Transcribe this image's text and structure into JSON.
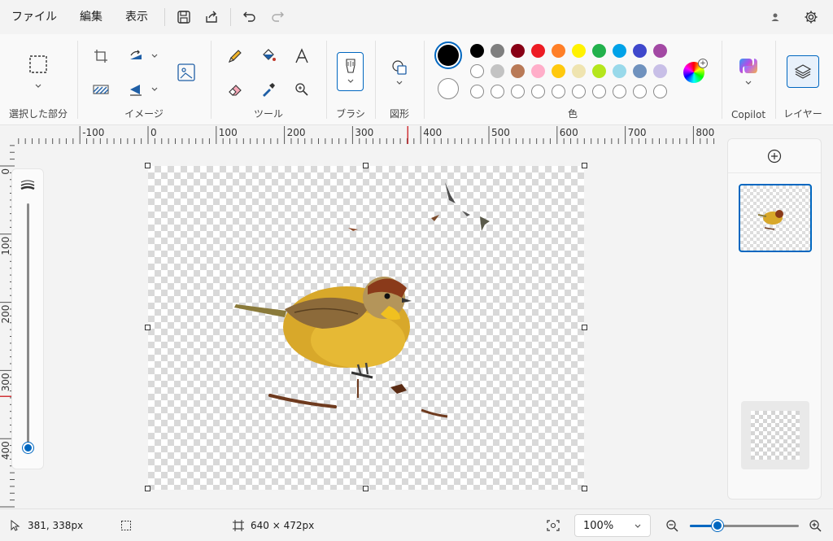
{
  "menu": {
    "file": "ファイル",
    "edit": "編集",
    "view": "表示"
  },
  "ribbon": {
    "selection_label": "選択した部分",
    "image_label": "イメージ",
    "tools_label": "ツール",
    "brush_label": "ブラシ",
    "shapes_label": "図形",
    "color_label": "色",
    "copilot_label": "Copilot",
    "layers_label": "レイヤー"
  },
  "colors": {
    "row1": [
      "#000000",
      "#7f7f7f",
      "#880015",
      "#ed1c24",
      "#ff7f27",
      "#fff200",
      "#22b14c",
      "#00a2e8",
      "#3f48cc",
      "#a349a4"
    ],
    "row2": [
      "#ffffff",
      "#c3c3c3",
      "#b97a57",
      "#ffaec9",
      "#ffc90e",
      "#efe4b0",
      "#b5e61d",
      "#99d9ea",
      "#7092be",
      "#c8bfe7"
    ],
    "row3_empty_count": 10,
    "primary": "#000000",
    "secondary": "#ffffff",
    "accent": "#0067c0"
  },
  "ruler": {
    "h_labels": [
      "-100",
      "0",
      "100",
      "200",
      "300",
      "400",
      "500",
      "600",
      "700",
      "800"
    ],
    "v_labels": [
      "0",
      "100",
      "200",
      "300",
      "400"
    ]
  },
  "status": {
    "cursor_pos": "381, 338px",
    "canvas_size": "640 × 472px",
    "zoom": "100%"
  },
  "zoom_slider_level": 0.25,
  "vertical_zoom_level": 0.0
}
